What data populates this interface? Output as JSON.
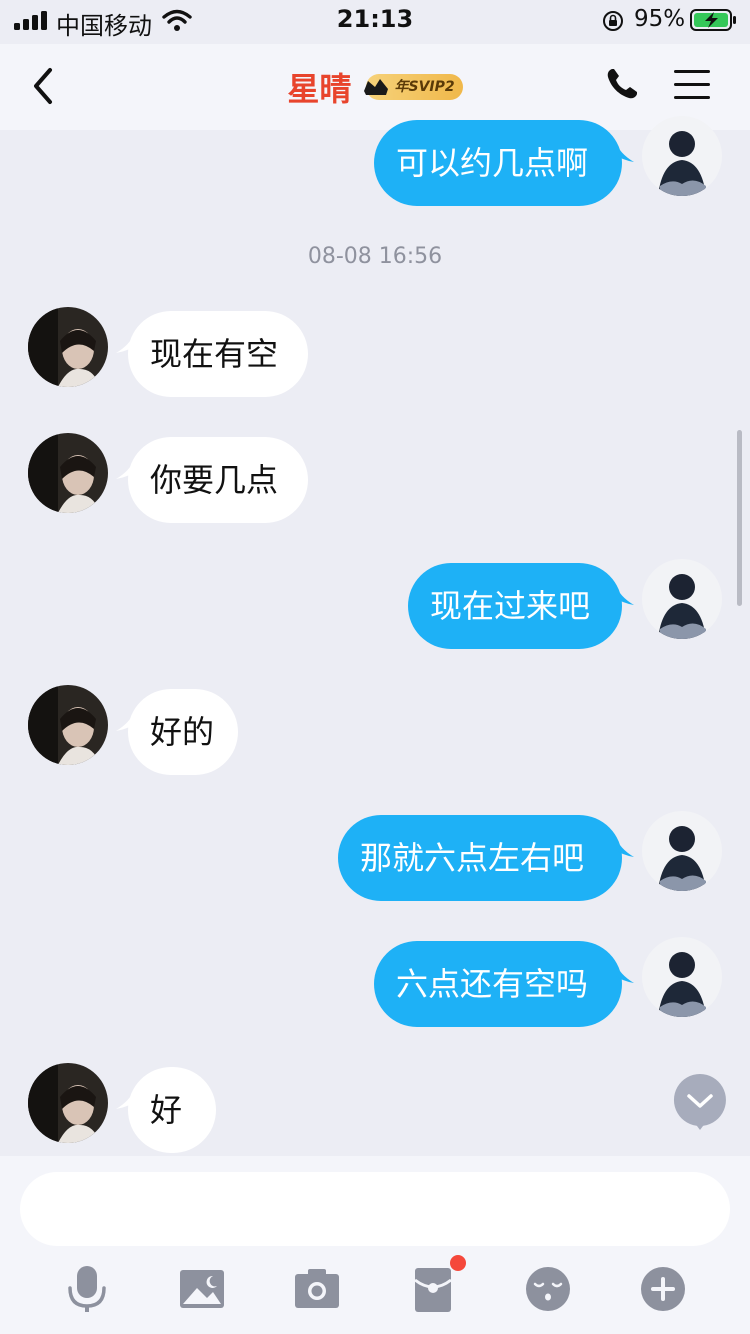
{
  "status_bar": {
    "carrier": "中国移动",
    "time": "21:13",
    "battery_percent": "95%"
  },
  "nav": {
    "title": "星晴",
    "badge": "年SVIP2"
  },
  "messages": [
    {
      "side": "right",
      "text": "可以约几点啊"
    },
    {
      "side": "left",
      "text": "现在有空"
    },
    {
      "side": "left",
      "text": "你要几点"
    },
    {
      "side": "right",
      "text": "现在过来吧"
    },
    {
      "side": "left",
      "text": "好的"
    },
    {
      "side": "right",
      "text": "那就六点左右吧"
    },
    {
      "side": "right",
      "text": "六点还有空吗"
    },
    {
      "side": "left",
      "text": "好"
    }
  ],
  "timestamp": "08-08 16:56",
  "input": {
    "value": "",
    "placeholder": ""
  },
  "toolbar": [
    "mic-icon",
    "image-icon",
    "camera-icon",
    "red-packet-icon",
    "emoji-icon",
    "plus-icon"
  ],
  "colors": {
    "accent": "#1eb1f6",
    "title": "#e8442c",
    "background": "#ecedf4"
  }
}
